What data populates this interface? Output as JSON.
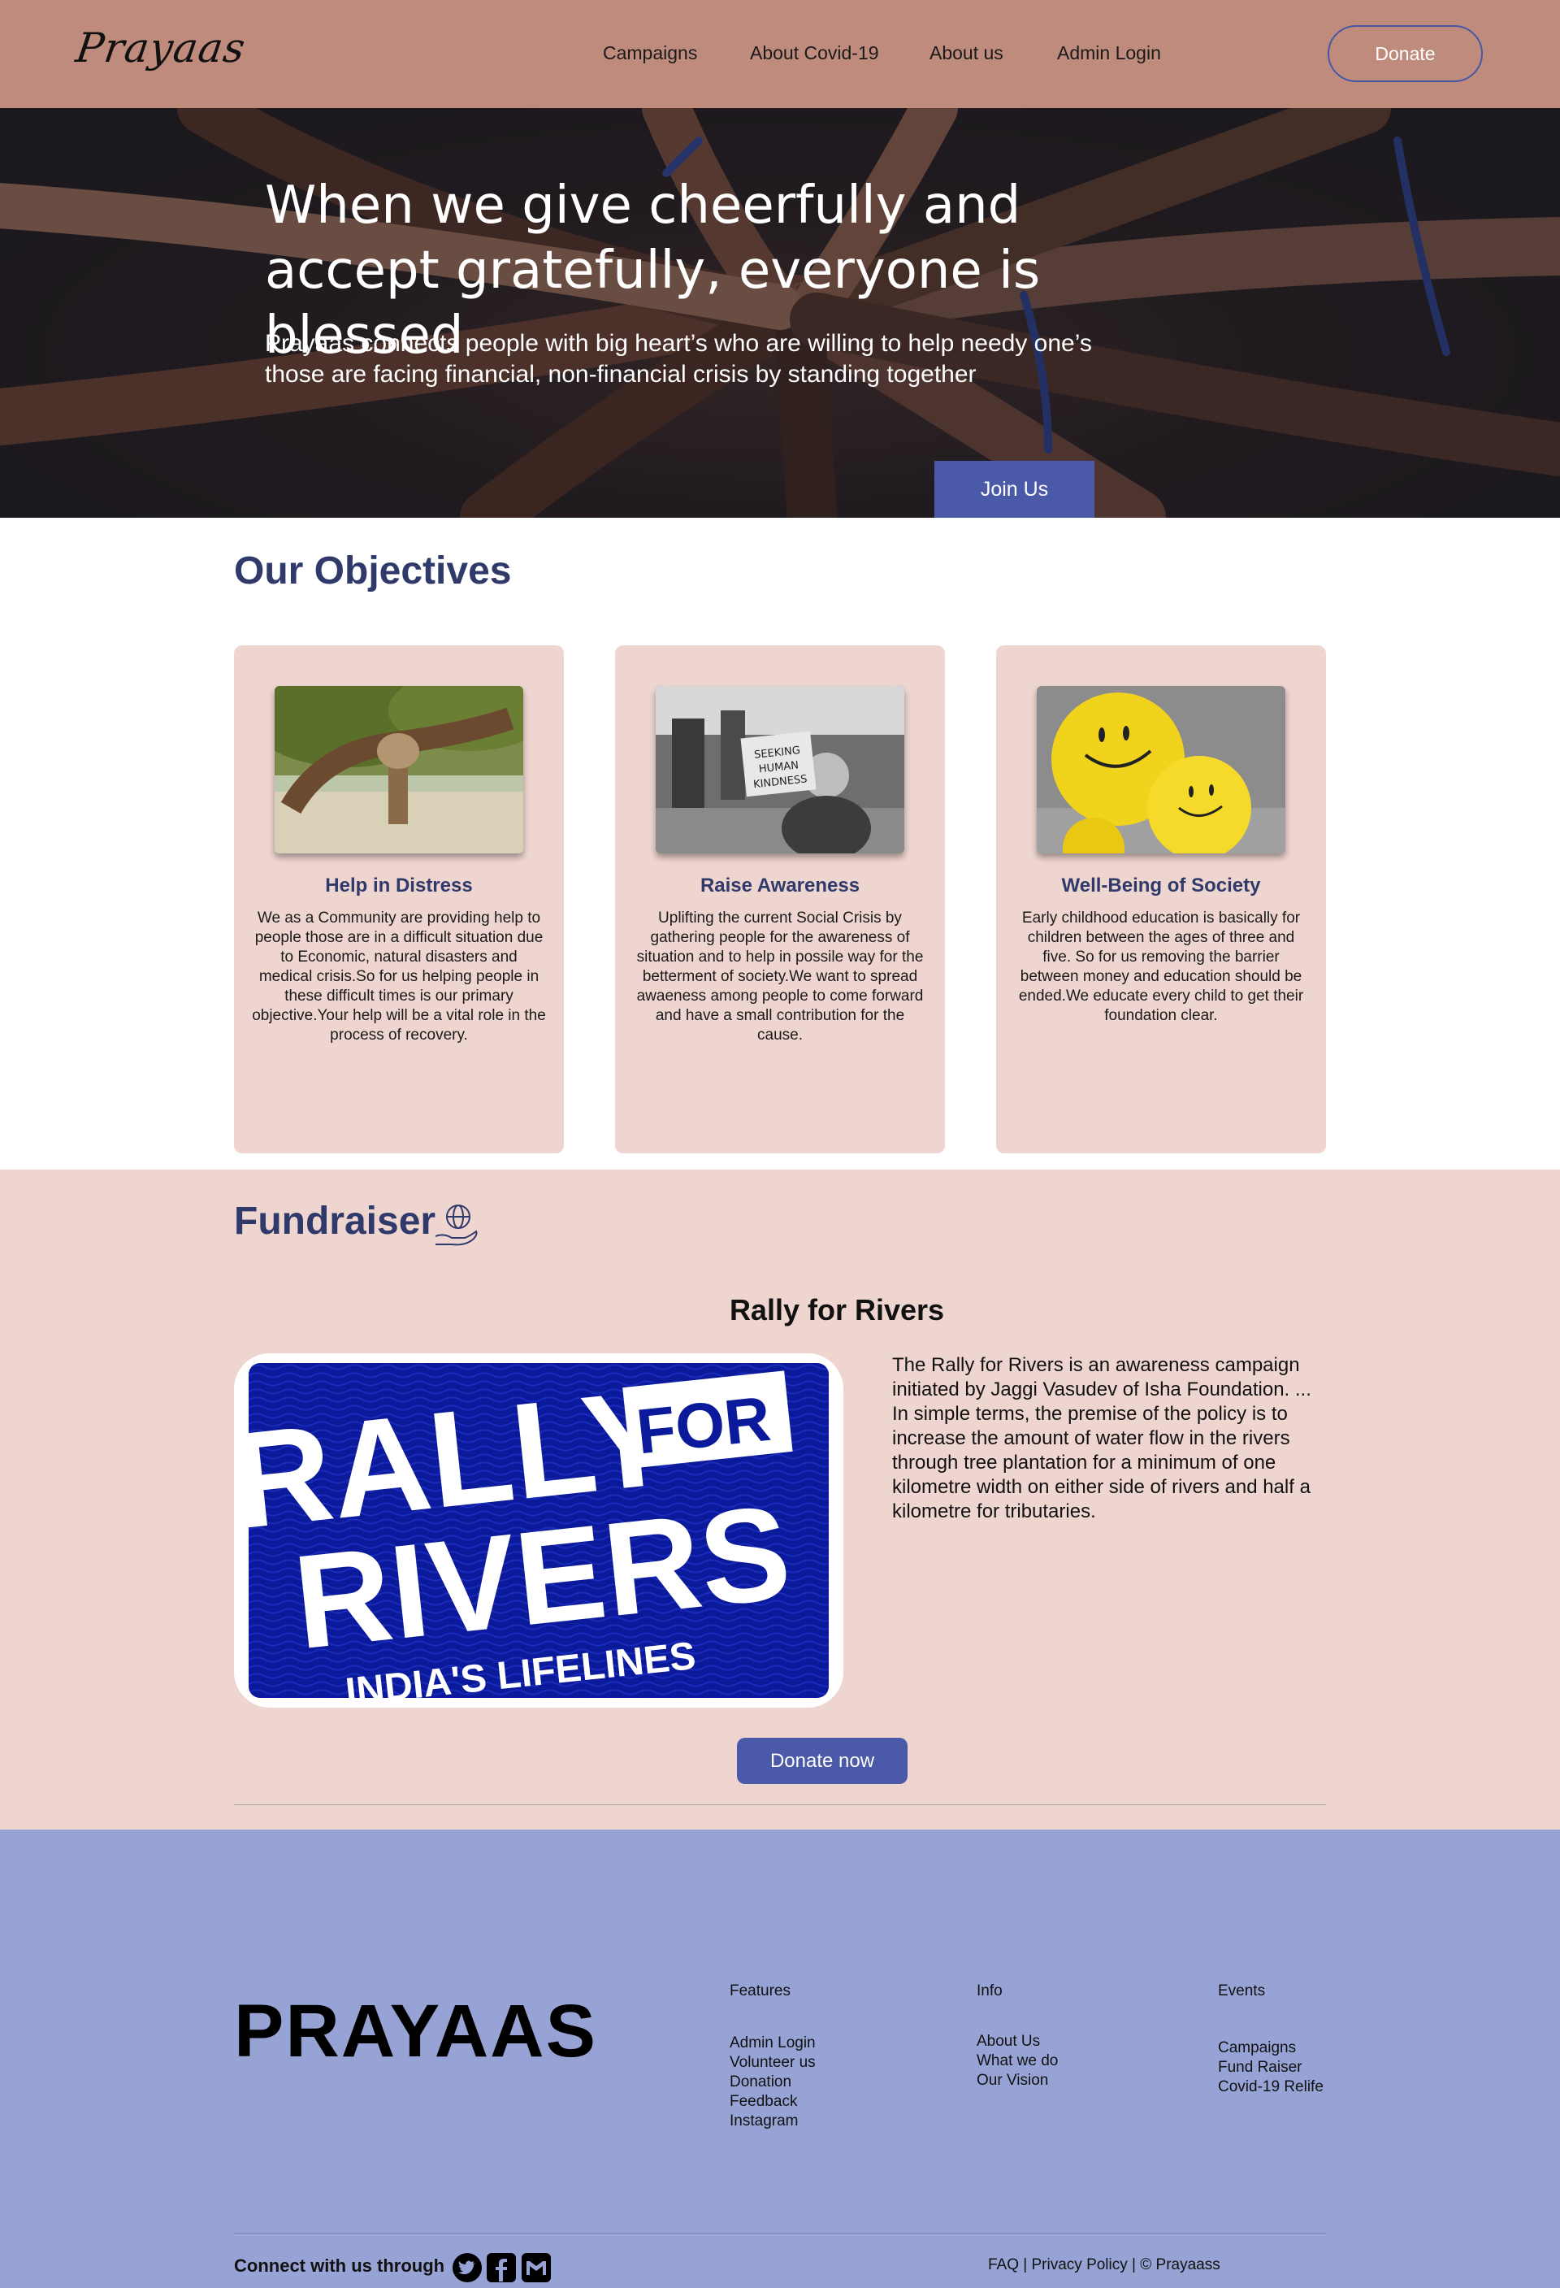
{
  "nav": {
    "logo": "Prayaas",
    "links": [
      "Campaigns",
      "About Covid-19",
      "About us",
      "Admin Login"
    ],
    "donate_label": "Donate"
  },
  "hero": {
    "title": "When we give cheerfully and accept gratefully, everyone is blessed",
    "subtitle": "Prayaas connects people with big heart’s who are willing to help needy one’s those are facing financial, non-financial crisis by standing together",
    "cta": "Join Us"
  },
  "objectives": {
    "title": "Our Objectives",
    "cards": [
      {
        "heading": "Help in Distress",
        "text": "We as a Community are providing help to people those are in a difficult situation due to Economic, natural disasters and medical crisis.So for us helping people in these difficult times is our primary objective.Your help will be a vital role in the process of recovery."
      },
      {
        "heading": "Raise Awareness",
        "text": "Uplifting the current Social Crisis by gathering people for the awareness of situation and to help in possile way for the betterment of society.We want to spread awaeness among people to come forward and have a small contribution for the cause."
      },
      {
        "heading": "Well-Being of Society",
        "text": "Early childhood education is basically for children between the ages of three and five. So for us removing the barrier between money and education should be ended.We educate every child to get their foundation clear."
      }
    ],
    "sign_text": [
      "SEEKING",
      "HUMAN",
      "KINDNESS"
    ]
  },
  "fundraiser": {
    "title": "Fundraiser",
    "campaign_title": "Rally for Rivers",
    "banner": {
      "line1": "RALLY",
      "line2": "FOR",
      "line3": "RIVERS",
      "line4": "INDIA'S LIFELINES"
    },
    "description": "The Rally for Rivers is an awareness campaign initiated by Jaggi Vasudev of Isha Foundation. ... In simple terms, the premise of the policy is to increase the amount of water flow in the rivers through tree plantation for a minimum of one kilometre width on either side of rivers and half a kilometre for tributaries.",
    "cta": "Donate now"
  },
  "footer": {
    "logo": "PRAYAAS",
    "features": {
      "title": "Features",
      "links": [
        "Admin Login",
        "Volunteer us",
        "Donation",
        "Feedback",
        "Instagram"
      ]
    },
    "info": {
      "title": "Info",
      "links": [
        "About Us",
        "What we do",
        "Our Vision"
      ]
    },
    "events": {
      "title": "Events",
      "links": [
        "Campaigns",
        "Fund Raiser",
        "Covid-19 Relife"
      ]
    },
    "connect": "Connect with us through",
    "legal": "FAQ | Privacy Policy | © Prayaass"
  },
  "colors": {
    "nav_bg": "#bf8b7c",
    "accent": "#4a59a8",
    "heading": "#2f3a6b",
    "card_bg": "#efd5cf",
    "footer_bg": "#97a3d5"
  },
  "icons": [
    "twitter-icon",
    "facebook-icon",
    "gmail-icon",
    "globe-hand-icon"
  ]
}
